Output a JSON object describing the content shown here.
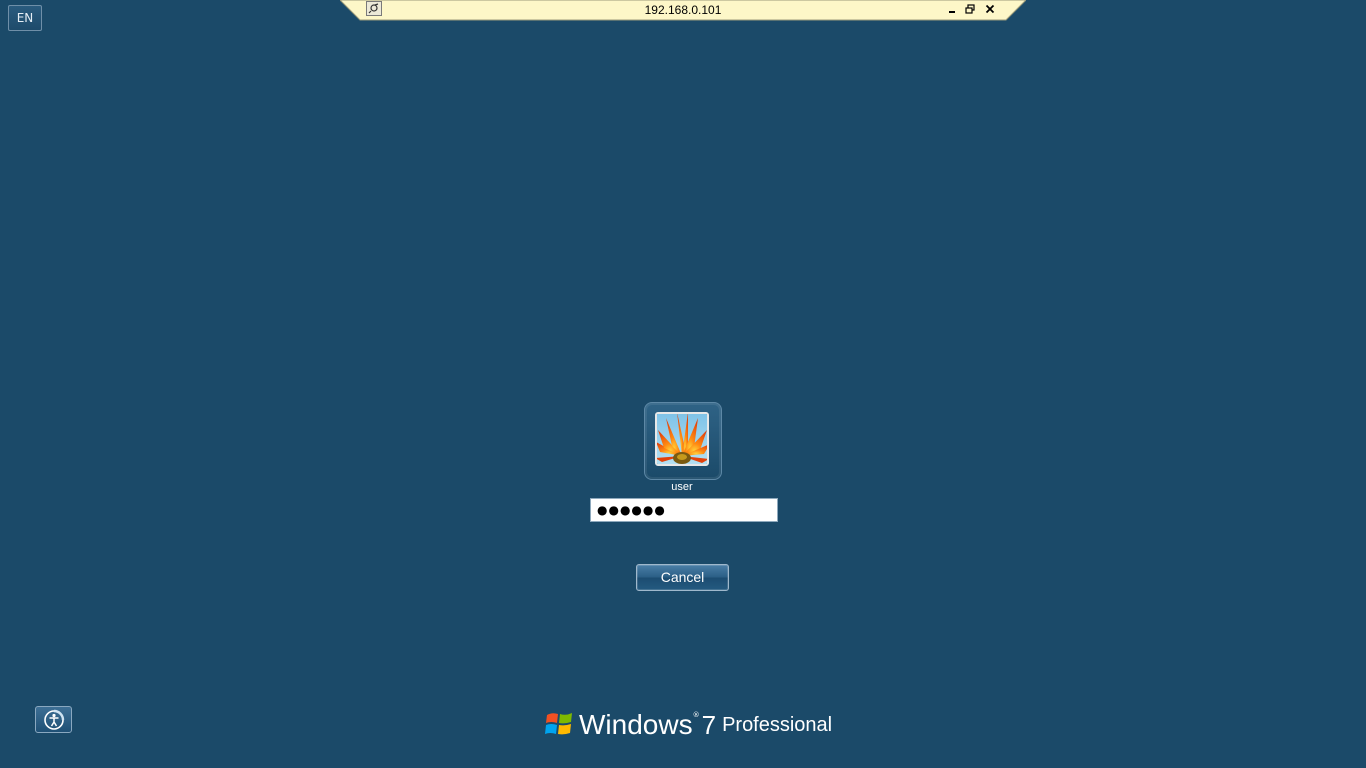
{
  "language_indicator": "EN",
  "connection_bar": {
    "title": "192.168.0.101",
    "buttons": [
      "pin-icon",
      "minimize-icon",
      "restore-icon",
      "close-icon"
    ]
  },
  "login": {
    "username": "user",
    "password_masked": "●●●●●●",
    "cancel_label": "Cancel"
  },
  "branding": {
    "word": "Windows",
    "version": "7",
    "edition": "Professional"
  },
  "icons": {
    "ease_of_access": "ease-of-access-icon",
    "user_picture": "flower-picture"
  },
  "colors": {
    "background": "#1b4a69",
    "connection_bar": "#fdf7c8"
  }
}
